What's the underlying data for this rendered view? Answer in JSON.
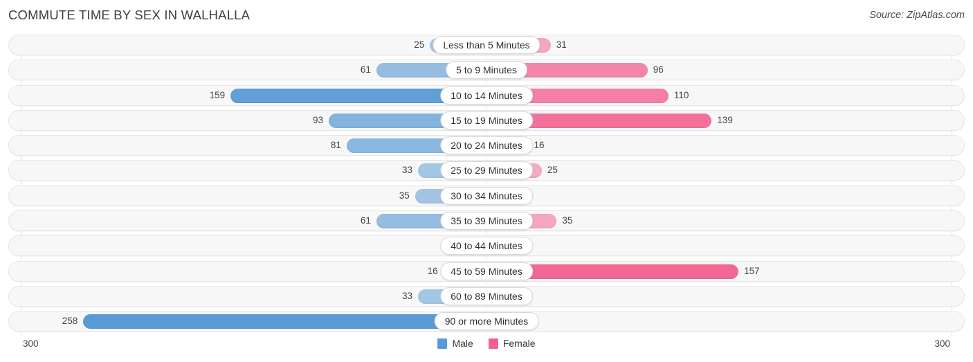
{
  "header": {
    "title": "COMMUTE TIME BY SEX IN WALHALLA",
    "source": "Source: ZipAtlas.com"
  },
  "legend": {
    "male_label": "Male",
    "female_label": "Female",
    "male_color": "#5b9bd5",
    "female_color": "#f2608e"
  },
  "axis": {
    "left_label": "300",
    "right_label": "300",
    "max": 300
  },
  "chart_data": {
    "type": "bar",
    "orientation": "horizontal-diverging",
    "title": "COMMUTE TIME BY SEX IN WALHALLA",
    "xlabel": "",
    "ylabel": "",
    "xlim": [
      300,
      300
    ],
    "grid": true,
    "legend_position": "bottom-center",
    "categories": [
      "Less than 5 Minutes",
      "5 to 9 Minutes",
      "10 to 14 Minutes",
      "15 to 19 Minutes",
      "20 to 24 Minutes",
      "25 to 29 Minutes",
      "30 to 34 Minutes",
      "35 to 39 Minutes",
      "40 to 44 Minutes",
      "45 to 59 Minutes",
      "60 to 89 Minutes",
      "90 or more Minutes"
    ],
    "series": [
      {
        "name": "Male",
        "color": "#5b9bd5",
        "values": [
          25,
          61,
          159,
          93,
          81,
          33,
          35,
          61,
          0,
          16,
          33,
          258
        ]
      },
      {
        "name": "Female",
        "color": "#f2608e",
        "values": [
          31,
          96,
          110,
          139,
          16,
          25,
          0,
          35,
          0,
          157,
          0,
          0
        ]
      }
    ]
  },
  "rows": [
    {
      "label": "Less than 5 Minutes",
      "male": "25",
      "female": "31"
    },
    {
      "label": "5 to 9 Minutes",
      "male": "61",
      "female": "96"
    },
    {
      "label": "10 to 14 Minutes",
      "male": "159",
      "female": "110"
    },
    {
      "label": "15 to 19 Minutes",
      "male": "93",
      "female": "139"
    },
    {
      "label": "20 to 24 Minutes",
      "male": "81",
      "female": "16"
    },
    {
      "label": "25 to 29 Minutes",
      "male": "33",
      "female": "25"
    },
    {
      "label": "30 to 34 Minutes",
      "male": "35",
      "female": "0"
    },
    {
      "label": "35 to 39 Minutes",
      "male": "61",
      "female": "35"
    },
    {
      "label": "40 to 44 Minutes",
      "male": "0",
      "female": "0"
    },
    {
      "label": "45 to 59 Minutes",
      "male": "16",
      "female": "157"
    },
    {
      "label": "60 to 89 Minutes",
      "male": "33",
      "female": "0"
    },
    {
      "label": "90 or more Minutes",
      "male": "258",
      "female": "0"
    }
  ]
}
